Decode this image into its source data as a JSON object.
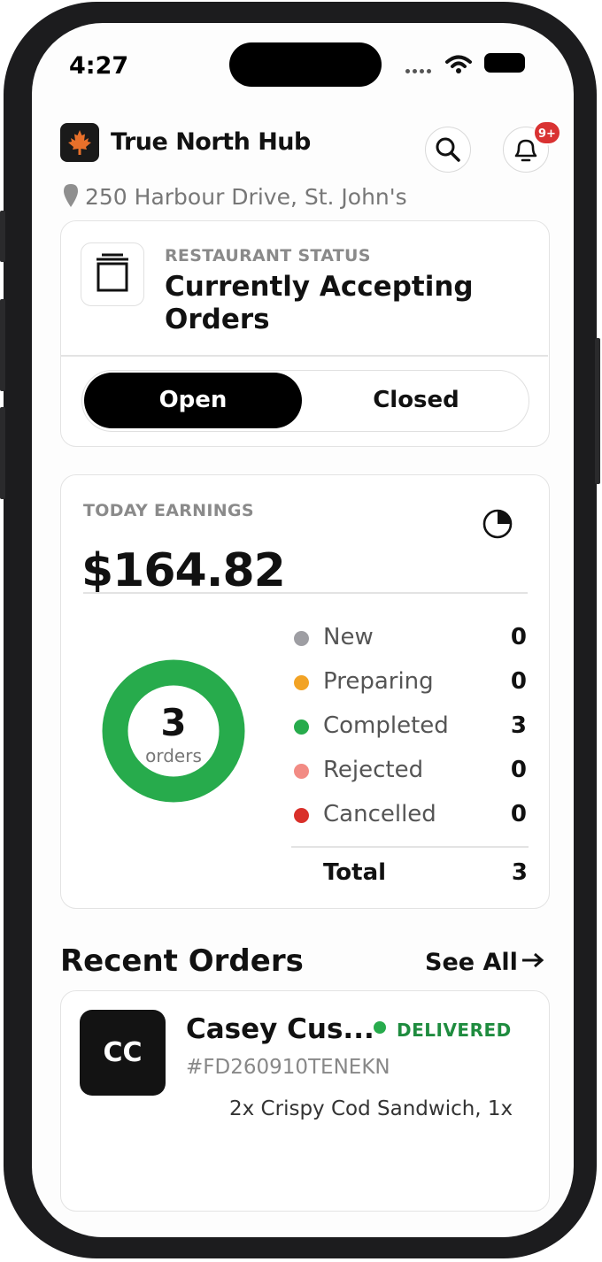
{
  "status_bar": {
    "time": "4:27"
  },
  "header": {
    "brand": "True North Hub",
    "notification_count": "9+",
    "address": "250 Harbour Drive, St. John's"
  },
  "restaurant_status": {
    "label": "RESTAURANT STATUS",
    "title": "Currently Accepting Orders",
    "toggle": {
      "open_label": "Open",
      "closed_label": "Closed",
      "selected": "Open"
    }
  },
  "earnings": {
    "label": "TODAY EARNINGS",
    "amount": "$164.82",
    "donut": {
      "count": "3",
      "unit": "orders"
    },
    "rows": [
      {
        "name": "New",
        "count": "0",
        "color": "#9e9ea3"
      },
      {
        "name": "Preparing",
        "count": "0",
        "color": "#f2a325"
      },
      {
        "name": "Completed",
        "count": "3",
        "color": "#27ab4c"
      },
      {
        "name": "Rejected",
        "count": "0",
        "color": "#f28b84"
      },
      {
        "name": "Cancelled",
        "count": "0",
        "color": "#d9302a"
      }
    ],
    "total_label": "Total",
    "total_count": "3"
  },
  "recent_orders": {
    "title": "Recent Orders",
    "see_all": "See All",
    "orders": [
      {
        "initials": "CC",
        "customer": "Casey Cus...",
        "status": "DELIVERED",
        "status_color": "#1f8c3f",
        "order_id": "#FD260910TENEKN",
        "items": "2x Crispy Cod Sandwich, 1x"
      }
    ]
  }
}
